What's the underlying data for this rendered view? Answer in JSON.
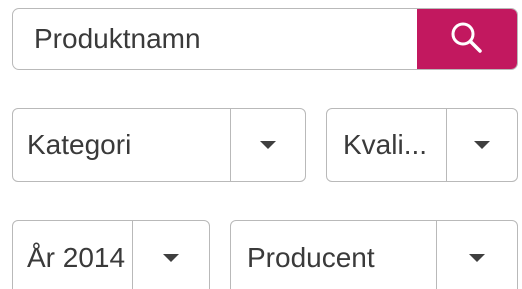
{
  "search": {
    "placeholder": "Produktnamn",
    "button_icon": "search-icon"
  },
  "filters": {
    "kategori": "Kategori",
    "kvalitet": "Kvali...",
    "year": "År 2014",
    "producent": "Producent"
  },
  "colors": {
    "accent": "#c2185f",
    "border": "#b9b9b9",
    "text": "#3a3a3a"
  }
}
